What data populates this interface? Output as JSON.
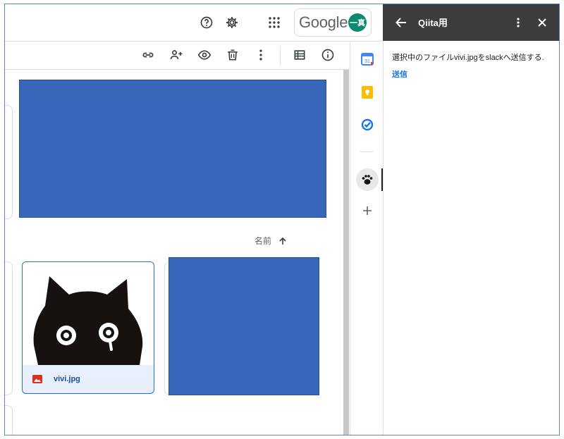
{
  "header": {
    "help_icon": "help-circle-icon",
    "settings_icon": "gear-icon",
    "apps_icon": "apps-grid-icon",
    "brand": "Google",
    "avatar_text": "一真",
    "avatar_color": "#0b8a6f"
  },
  "toolbar": {
    "icons": [
      "link-icon",
      "add-person-icon",
      "preview-eye-icon",
      "trash-icon",
      "more-vert-icon",
      "list-view-icon",
      "info-icon"
    ]
  },
  "content": {
    "sort_label": "名前",
    "sort_direction_icon": "arrow-up-icon",
    "file": {
      "name": "vivi.jpg",
      "type_icon": "image-file-icon"
    },
    "redacted_color": "#3766bb"
  },
  "rail": {
    "items": [
      "calendar-icon",
      "keep-icon",
      "tasks-icon",
      "paw-addon-icon",
      "add-icon"
    ]
  },
  "side_panel": {
    "title": "Qiita用",
    "message": "選択中のファイルvivi.jpgをslackへ送信する.",
    "send_label": "送信",
    "back_icon": "arrow-back-icon",
    "more_icon": "more-vert-icon",
    "close_icon": "close-icon",
    "header_bg": "#3c3c3c"
  }
}
